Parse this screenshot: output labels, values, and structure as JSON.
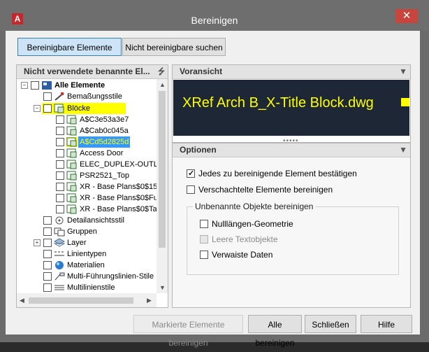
{
  "window": {
    "title": "Bereinigen",
    "close_glyph": "✕",
    "app_icon_letter": "A"
  },
  "top_tabs": {
    "purgeable": "Bereinigbare Elemente",
    "non_purgeable": "Nicht bereinigbare suchen"
  },
  "left_panel": {
    "header": "Nicht verwendete benannte El...",
    "tree": [
      {
        "label": "Alle Elemente",
        "bold": true,
        "icon": "all-items-icon",
        "level": 0
      },
      {
        "label": "Bemaßungsstile",
        "icon": "dimension-style-icon",
        "level": 1
      },
      {
        "label": "Blöcke",
        "icon": "block-icon",
        "level": 1,
        "highlight": "#ffff00"
      },
      {
        "label": "A$C3e53a3e7",
        "icon": "block-icon",
        "level": 2
      },
      {
        "label": "A$Cab0c045a",
        "icon": "block-icon",
        "level": 2
      },
      {
        "label": "A$Cd5d2825d",
        "icon": "block-icon",
        "level": 2,
        "selected": true
      },
      {
        "label": "Access Door",
        "icon": "block-icon",
        "level": 2
      },
      {
        "label": "ELEC_DUPLEX-OUTL",
        "icon": "block-icon",
        "level": 2
      },
      {
        "label": "PSR2521_Top",
        "icon": "block-icon",
        "level": 2
      },
      {
        "label": "XR - Base Plans$0$15",
        "icon": "block-icon",
        "level": 2
      },
      {
        "label": "XR - Base Plans$0$Fu",
        "icon": "block-icon",
        "level": 2
      },
      {
        "label": "XR - Base Plans$0$Ta",
        "icon": "block-icon",
        "level": 2
      },
      {
        "label": "Detailansichtsstil",
        "icon": "detail-view-icon",
        "level": 1
      },
      {
        "label": "Gruppen",
        "icon": "group-icon",
        "level": 1
      },
      {
        "label": "Layer",
        "icon": "layer-icon",
        "level": 1
      },
      {
        "label": "Linientypen",
        "icon": "linetype-icon",
        "level": 1
      },
      {
        "label": "Materialien",
        "icon": "material-icon",
        "level": 1
      },
      {
        "label": "Multi-Führungslinien-Stile",
        "icon": "multileader-icon",
        "level": 1
      },
      {
        "label": "Multilinienstile",
        "icon": "multiline-icon",
        "level": 1
      }
    ]
  },
  "preview_panel": {
    "header": "Voransicht",
    "preview_text": "XRef Arch B_X-Title Block.dwg",
    "preview_bg": "#1d2735",
    "preview_fg": "#ffff00"
  },
  "options_panel": {
    "header": "Optionen",
    "confirm_each": {
      "label": "Jedes zu bereinigende Element bestätigen",
      "checked": true
    },
    "nested": {
      "label": "Verschachtelte Elemente bereinigen",
      "checked": false
    },
    "unnamed_group": {
      "title": "Unbenannte Objekte bereinigen",
      "zero_length": {
        "label": "Nulllängen-Geometrie",
        "checked": false
      },
      "empty_text": {
        "label": "Leere Textobjekte",
        "checked": false,
        "disabled": true
      },
      "orphaned": {
        "label": "Verwaiste Daten",
        "checked": false
      }
    }
  },
  "bottom_buttons": {
    "purge_checked": "Markierte Elemente bereinigen",
    "purge_all": "Alle bereinigen",
    "close": "Schließen",
    "help": "Hilfe"
  }
}
